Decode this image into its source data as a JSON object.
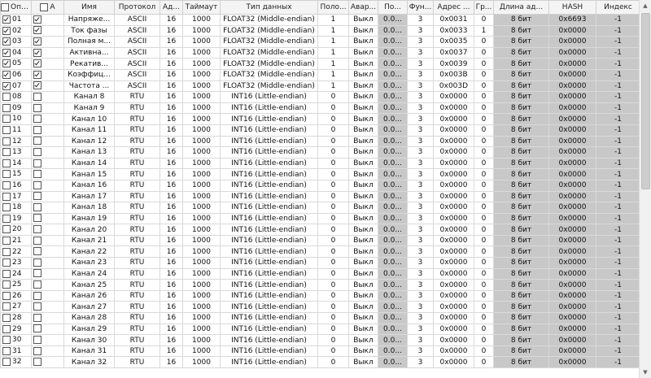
{
  "header": {
    "poll": "Опрос",
    "col2": "А",
    "name": "Имя",
    "protocol": "Протокол",
    "addr": "Ад...",
    "timeout": "Таймаут",
    "dtype": "Тип данных",
    "pos": "Поло...",
    "alarm": "Авар...",
    "po": "По...",
    "func": "Фун...",
    "regaddr": "Адрес ...",
    "gr": "Гр...",
    "len": "Длина ад...",
    "hash": "HASH",
    "index": "Индекс"
  },
  "rows": [
    {
      "num": "01",
      "poll": true,
      "a": true,
      "name": "Напряже...",
      "protocol": "ASCII",
      "addr": "16",
      "timeout": "1000",
      "dtype": "FLOAT32 (Middle-endian)",
      "pos": "1",
      "alarm": "Выкл",
      "po": "0.0...",
      "func": "3",
      "reg": "0x0031",
      "gr": "0",
      "len": "8 бит",
      "hash": "0x6693",
      "index": "-1"
    },
    {
      "num": "02",
      "poll": true,
      "a": true,
      "name": "Ток фазы",
      "protocol": "ASCII",
      "addr": "16",
      "timeout": "1000",
      "dtype": "FLOAT32 (Middle-endian)",
      "pos": "1",
      "alarm": "Выкл",
      "po": "0.0...",
      "func": "3",
      "reg": "0x0033",
      "gr": "1",
      "len": "8 бит",
      "hash": "0x0000",
      "index": "-1"
    },
    {
      "num": "03",
      "poll": true,
      "a": true,
      "name": "Полная м...",
      "protocol": "ASCII",
      "addr": "16",
      "timeout": "1000",
      "dtype": "FLOAT32 (Middle-endian)",
      "pos": "1",
      "alarm": "Выкл",
      "po": "0.0...",
      "func": "3",
      "reg": "0x0035",
      "gr": "0",
      "len": "8 бит",
      "hash": "0x0000",
      "index": "-1"
    },
    {
      "num": "04",
      "poll": true,
      "a": true,
      "name": "Активна...",
      "protocol": "ASCII",
      "addr": "16",
      "timeout": "1000",
      "dtype": "FLOAT32 (Middle-endian)",
      "pos": "1",
      "alarm": "Выкл",
      "po": "0.0...",
      "func": "3",
      "reg": "0x0037",
      "gr": "0",
      "len": "8 бит",
      "hash": "0x0000",
      "index": "-1"
    },
    {
      "num": "05",
      "poll": true,
      "a": true,
      "name": "Рекатив...",
      "protocol": "ASCII",
      "addr": "16",
      "timeout": "1000",
      "dtype": "FLOAT32 (Middle-endian)",
      "pos": "1",
      "alarm": "Выкл",
      "po": "0.0...",
      "func": "3",
      "reg": "0x0039",
      "gr": "0",
      "len": "8 бит",
      "hash": "0x0000",
      "index": "-1"
    },
    {
      "num": "06",
      "poll": true,
      "a": true,
      "name": "Коэффиц...",
      "protocol": "ASCII",
      "addr": "16",
      "timeout": "1000",
      "dtype": "FLOAT32 (Middle-endian)",
      "pos": "1",
      "alarm": "Выкл",
      "po": "0.0...",
      "func": "3",
      "reg": "0x003B",
      "gr": "0",
      "len": "8 бит",
      "hash": "0x0000",
      "index": "-1"
    },
    {
      "num": "07",
      "poll": true,
      "a": true,
      "name": "Частота ...",
      "protocol": "ASCII",
      "addr": "16",
      "timeout": "1000",
      "dtype": "FLOAT32 (Middle-endian)",
      "pos": "1",
      "alarm": "Выкл",
      "po": "0.0...",
      "func": "3",
      "reg": "0x003D",
      "gr": "0",
      "len": "8 бит",
      "hash": "0x0000",
      "index": "-1"
    },
    {
      "num": "08",
      "poll": false,
      "a": false,
      "name": "Канал 8",
      "protocol": "RTU",
      "addr": "16",
      "timeout": "1000",
      "dtype": "INT16 (Little-endian)",
      "pos": "0",
      "alarm": "Выкл",
      "po": "0.0...",
      "func": "3",
      "reg": "0x0000",
      "gr": "0",
      "len": "8 бит",
      "hash": "0x0000",
      "index": "-1"
    },
    {
      "num": "09",
      "poll": false,
      "a": false,
      "name": "Канал 9",
      "protocol": "RTU",
      "addr": "16",
      "timeout": "1000",
      "dtype": "INT16 (Little-endian)",
      "pos": "0",
      "alarm": "Выкл",
      "po": "0.0...",
      "func": "3",
      "reg": "0x0000",
      "gr": "0",
      "len": "8 бит",
      "hash": "0x0000",
      "index": "-1"
    },
    {
      "num": "10",
      "poll": false,
      "a": false,
      "name": "Канал 10",
      "protocol": "RTU",
      "addr": "16",
      "timeout": "1000",
      "dtype": "INT16 (Little-endian)",
      "pos": "0",
      "alarm": "Выкл",
      "po": "0.0...",
      "func": "3",
      "reg": "0x0000",
      "gr": "0",
      "len": "8 бит",
      "hash": "0x0000",
      "index": "-1"
    },
    {
      "num": "11",
      "poll": false,
      "a": false,
      "name": "Канал 11",
      "protocol": "RTU",
      "addr": "16",
      "timeout": "1000",
      "dtype": "INT16 (Little-endian)",
      "pos": "0",
      "alarm": "Выкл",
      "po": "0.0...",
      "func": "3",
      "reg": "0x0000",
      "gr": "0",
      "len": "8 бит",
      "hash": "0x0000",
      "index": "-1"
    },
    {
      "num": "12",
      "poll": false,
      "a": false,
      "name": "Канал 12",
      "protocol": "RTU",
      "addr": "16",
      "timeout": "1000",
      "dtype": "INT16 (Little-endian)",
      "pos": "0",
      "alarm": "Выкл",
      "po": "0.0...",
      "func": "3",
      "reg": "0x0000",
      "gr": "0",
      "len": "8 бит",
      "hash": "0x0000",
      "index": "-1"
    },
    {
      "num": "13",
      "poll": false,
      "a": false,
      "name": "Канал 13",
      "protocol": "RTU",
      "addr": "16",
      "timeout": "1000",
      "dtype": "INT16 (Little-endian)",
      "pos": "0",
      "alarm": "Выкл",
      "po": "0.0...",
      "func": "3",
      "reg": "0x0000",
      "gr": "0",
      "len": "8 бит",
      "hash": "0x0000",
      "index": "-1"
    },
    {
      "num": "14",
      "poll": false,
      "a": false,
      "name": "Канал 14",
      "protocol": "RTU",
      "addr": "16",
      "timeout": "1000",
      "dtype": "INT16 (Little-endian)",
      "pos": "0",
      "alarm": "Выкл",
      "po": "0.0...",
      "func": "3",
      "reg": "0x0000",
      "gr": "0",
      "len": "8 бит",
      "hash": "0x0000",
      "index": "-1"
    },
    {
      "num": "15",
      "poll": false,
      "a": false,
      "name": "Канал 15",
      "protocol": "RTU",
      "addr": "16",
      "timeout": "1000",
      "dtype": "INT16 (Little-endian)",
      "pos": "0",
      "alarm": "Выкл",
      "po": "0.0...",
      "func": "3",
      "reg": "0x0000",
      "gr": "0",
      "len": "8 бит",
      "hash": "0x0000",
      "index": "-1"
    },
    {
      "num": "16",
      "poll": false,
      "a": false,
      "name": "Канал 16",
      "protocol": "RTU",
      "addr": "16",
      "timeout": "1000",
      "dtype": "INT16 (Little-endian)",
      "pos": "0",
      "alarm": "Выкл",
      "po": "0.0...",
      "func": "3",
      "reg": "0x0000",
      "gr": "0",
      "len": "8 бит",
      "hash": "0x0000",
      "index": "-1"
    },
    {
      "num": "17",
      "poll": false,
      "a": false,
      "name": "Канал 17",
      "protocol": "RTU",
      "addr": "16",
      "timeout": "1000",
      "dtype": "INT16 (Little-endian)",
      "pos": "0",
      "alarm": "Выкл",
      "po": "0.0...",
      "func": "3",
      "reg": "0x0000",
      "gr": "0",
      "len": "8 бит",
      "hash": "0x0000",
      "index": "-1"
    },
    {
      "num": "18",
      "poll": false,
      "a": false,
      "name": "Канал 18",
      "protocol": "RTU",
      "addr": "16",
      "timeout": "1000",
      "dtype": "INT16 (Little-endian)",
      "pos": "0",
      "alarm": "Выкл",
      "po": "0.0...",
      "func": "3",
      "reg": "0x0000",
      "gr": "0",
      "len": "8 бит",
      "hash": "0x0000",
      "index": "-1"
    },
    {
      "num": "19",
      "poll": false,
      "a": false,
      "name": "Канал 19",
      "protocol": "RTU",
      "addr": "16",
      "timeout": "1000",
      "dtype": "INT16 (Little-endian)",
      "pos": "0",
      "alarm": "Выкл",
      "po": "0.0...",
      "func": "3",
      "reg": "0x0000",
      "gr": "0",
      "len": "8 бит",
      "hash": "0x0000",
      "index": "-1"
    },
    {
      "num": "20",
      "poll": false,
      "a": false,
      "name": "Канал 20",
      "protocol": "RTU",
      "addr": "16",
      "timeout": "1000",
      "dtype": "INT16 (Little-endian)",
      "pos": "0",
      "alarm": "Выкл",
      "po": "0.0...",
      "func": "3",
      "reg": "0x0000",
      "gr": "0",
      "len": "8 бит",
      "hash": "0x0000",
      "index": "-1"
    },
    {
      "num": "21",
      "poll": false,
      "a": false,
      "name": "Канал 21",
      "protocol": "RTU",
      "addr": "16",
      "timeout": "1000",
      "dtype": "INT16 (Little-endian)",
      "pos": "0",
      "alarm": "Выкл",
      "po": "0.0...",
      "func": "3",
      "reg": "0x0000",
      "gr": "0",
      "len": "8 бит",
      "hash": "0x0000",
      "index": "-1"
    },
    {
      "num": "22",
      "poll": false,
      "a": false,
      "name": "Канал 22",
      "protocol": "RTU",
      "addr": "16",
      "timeout": "1000",
      "dtype": "INT16 (Little-endian)",
      "pos": "0",
      "alarm": "Выкл",
      "po": "0.0...",
      "func": "3",
      "reg": "0x0000",
      "gr": "0",
      "len": "8 бит",
      "hash": "0x0000",
      "index": "-1"
    },
    {
      "num": "23",
      "poll": false,
      "a": false,
      "name": "Канал 23",
      "protocol": "RTU",
      "addr": "16",
      "timeout": "1000",
      "dtype": "INT16 (Little-endian)",
      "pos": "0",
      "alarm": "Выкл",
      "po": "0.0...",
      "func": "3",
      "reg": "0x0000",
      "gr": "0",
      "len": "8 бит",
      "hash": "0x0000",
      "index": "-1"
    },
    {
      "num": "24",
      "poll": false,
      "a": false,
      "name": "Канал 24",
      "protocol": "RTU",
      "addr": "16",
      "timeout": "1000",
      "dtype": "INT16 (Little-endian)",
      "pos": "0",
      "alarm": "Выкл",
      "po": "0.0...",
      "func": "3",
      "reg": "0x0000",
      "gr": "0",
      "len": "8 бит",
      "hash": "0x0000",
      "index": "-1"
    },
    {
      "num": "25",
      "poll": false,
      "a": false,
      "name": "Канал 25",
      "protocol": "RTU",
      "addr": "16",
      "timeout": "1000",
      "dtype": "INT16 (Little-endian)",
      "pos": "0",
      "alarm": "Выкл",
      "po": "0.0...",
      "func": "3",
      "reg": "0x0000",
      "gr": "0",
      "len": "8 бит",
      "hash": "0x0000",
      "index": "-1"
    },
    {
      "num": "26",
      "poll": false,
      "a": false,
      "name": "Канал 26",
      "protocol": "RTU",
      "addr": "16",
      "timeout": "1000",
      "dtype": "INT16 (Little-endian)",
      "pos": "0",
      "alarm": "Выкл",
      "po": "0.0...",
      "func": "3",
      "reg": "0x0000",
      "gr": "0",
      "len": "8 бит",
      "hash": "0x0000",
      "index": "-1"
    },
    {
      "num": "27",
      "poll": false,
      "a": false,
      "name": "Канал 27",
      "protocol": "RTU",
      "addr": "16",
      "timeout": "1000",
      "dtype": "INT16 (Little-endian)",
      "pos": "0",
      "alarm": "Выкл",
      "po": "0.0...",
      "func": "3",
      "reg": "0x0000",
      "gr": "0",
      "len": "8 бит",
      "hash": "0x0000",
      "index": "-1"
    },
    {
      "num": "28",
      "poll": false,
      "a": false,
      "name": "Канал 28",
      "protocol": "RTU",
      "addr": "16",
      "timeout": "1000",
      "dtype": "INT16 (Little-endian)",
      "pos": "0",
      "alarm": "Выкл",
      "po": "0.0...",
      "func": "3",
      "reg": "0x0000",
      "gr": "0",
      "len": "8 бит",
      "hash": "0x0000",
      "index": "-1"
    },
    {
      "num": "29",
      "poll": false,
      "a": false,
      "name": "Канал 29",
      "protocol": "RTU",
      "addr": "16",
      "timeout": "1000",
      "dtype": "INT16 (Little-endian)",
      "pos": "0",
      "alarm": "Выкл",
      "po": "0.0...",
      "func": "3",
      "reg": "0x0000",
      "gr": "0",
      "len": "8 бит",
      "hash": "0x0000",
      "index": "-1"
    },
    {
      "num": "30",
      "poll": false,
      "a": false,
      "name": "Канал 30",
      "protocol": "RTU",
      "addr": "16",
      "timeout": "1000",
      "dtype": "INT16 (Little-endian)",
      "pos": "0",
      "alarm": "Выкл",
      "po": "0.0...",
      "func": "3",
      "reg": "0x0000",
      "gr": "0",
      "len": "8 бит",
      "hash": "0x0000",
      "index": "-1"
    },
    {
      "num": "31",
      "poll": false,
      "a": false,
      "name": "Канал 31",
      "protocol": "RTU",
      "addr": "16",
      "timeout": "1000",
      "dtype": "INT16 (Little-endian)",
      "pos": "0",
      "alarm": "Выкл",
      "po": "0.0...",
      "func": "3",
      "reg": "0x0000",
      "gr": "0",
      "len": "8 бит",
      "hash": "0x0000",
      "index": "-1"
    },
    {
      "num": "32",
      "poll": false,
      "a": false,
      "name": "Канал 32",
      "protocol": "RTU",
      "addr": "16",
      "timeout": "1000",
      "dtype": "INT16 (Little-endian)",
      "pos": "0",
      "alarm": "Выкл",
      "po": "0.0...",
      "func": "3",
      "reg": "0x0000",
      "gr": "0",
      "len": "8 бит",
      "hash": "0x0000",
      "index": "-1"
    }
  ],
  "colors": {
    "header_bg": "#f4f4f4",
    "grey_cell": "#c8c8c8",
    "grid_line": "#d9d9d9"
  },
  "scrollbar": {
    "up_icon": "triangle-up-icon",
    "down_icon": "triangle-down-icon"
  }
}
